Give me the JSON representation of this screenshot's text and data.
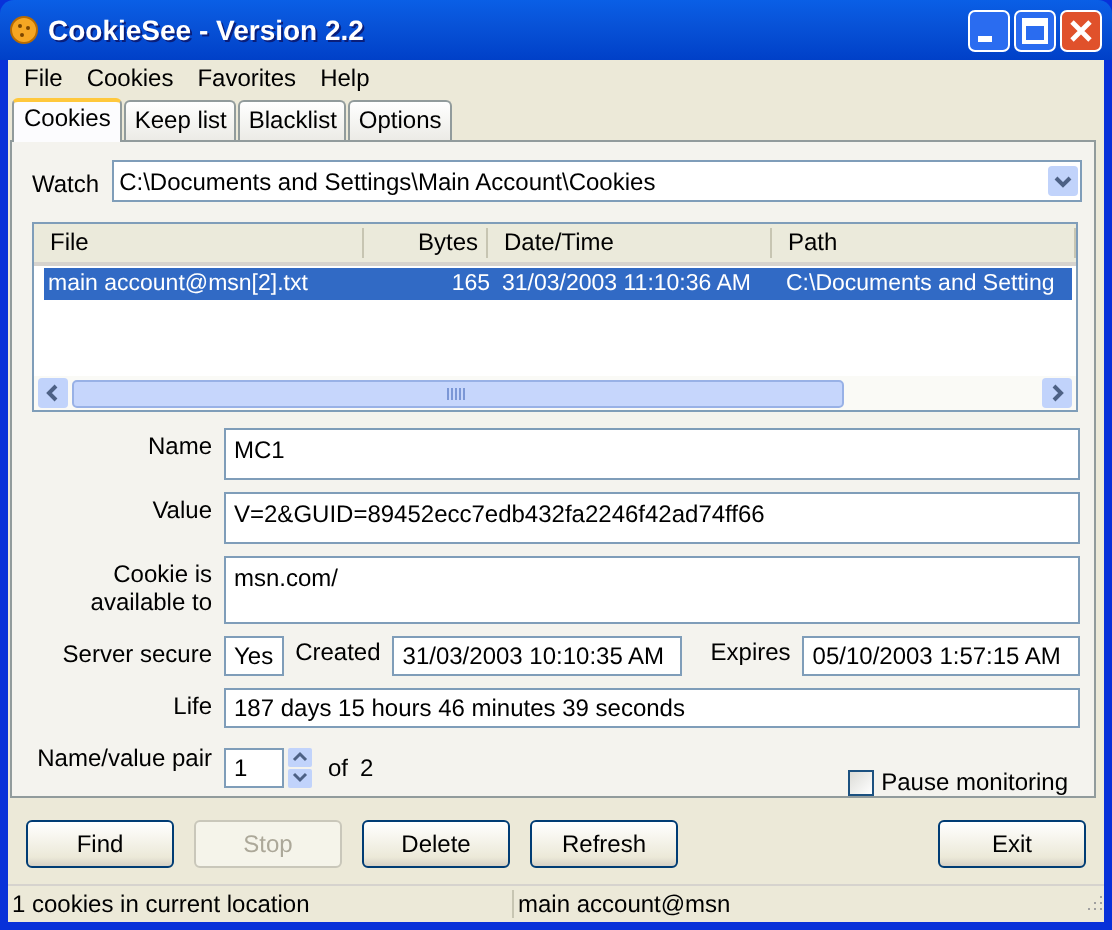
{
  "window": {
    "title": "CookieSee - Version 2.2"
  },
  "menu": [
    "File",
    "Cookies",
    "Favorites",
    "Help"
  ],
  "tabs": [
    {
      "label": "Cookies",
      "selected": true
    },
    {
      "label": "Keep list",
      "selected": false
    },
    {
      "label": "Blacklist",
      "selected": false
    },
    {
      "label": "Options",
      "selected": false
    }
  ],
  "watch": {
    "label": "Watch",
    "value": "C:\\Documents and Settings\\Main Account\\Cookies"
  },
  "table": {
    "columns": [
      "File",
      "Bytes",
      "Date/Time",
      "Path"
    ],
    "rows": [
      {
        "cells": [
          "main account@msn[2].txt",
          "165",
          "31/03/2003 11:10:36 AM",
          "C:\\Documents and Setting"
        ],
        "selected": true
      }
    ]
  },
  "details": {
    "name": {
      "label": "Name",
      "value": "MC1"
    },
    "value": {
      "label": "Value",
      "value": "V=2&GUID=89452ecc7edb432fa2246f42ad74ff66"
    },
    "available_to": {
      "label": "Cookie is available to",
      "value": "msn.com/"
    },
    "server_secure": {
      "label": "Server secure",
      "value": "Yes"
    },
    "created": {
      "label": "Created",
      "value": "31/03/2003 10:10:35 AM"
    },
    "expires": {
      "label": "Expires",
      "value": "05/10/2003 1:57:15 AM"
    },
    "life": {
      "label": "Life",
      "value": "187 days 15 hours 46 minutes 39 seconds"
    },
    "pair": {
      "label": "Name/value pair",
      "value": "1",
      "of_label": "of",
      "total": "2"
    },
    "pause": {
      "label": "Pause monitoring",
      "checked": false
    }
  },
  "buttons": [
    {
      "label": "Find",
      "disabled": false
    },
    {
      "label": "Stop",
      "disabled": true
    },
    {
      "label": "Delete",
      "disabled": false
    },
    {
      "label": "Refresh",
      "disabled": false
    },
    {
      "label": "Exit",
      "disabled": false
    }
  ],
  "status_bar": [
    "1 cookies in current location",
    "main account@msn"
  ]
}
